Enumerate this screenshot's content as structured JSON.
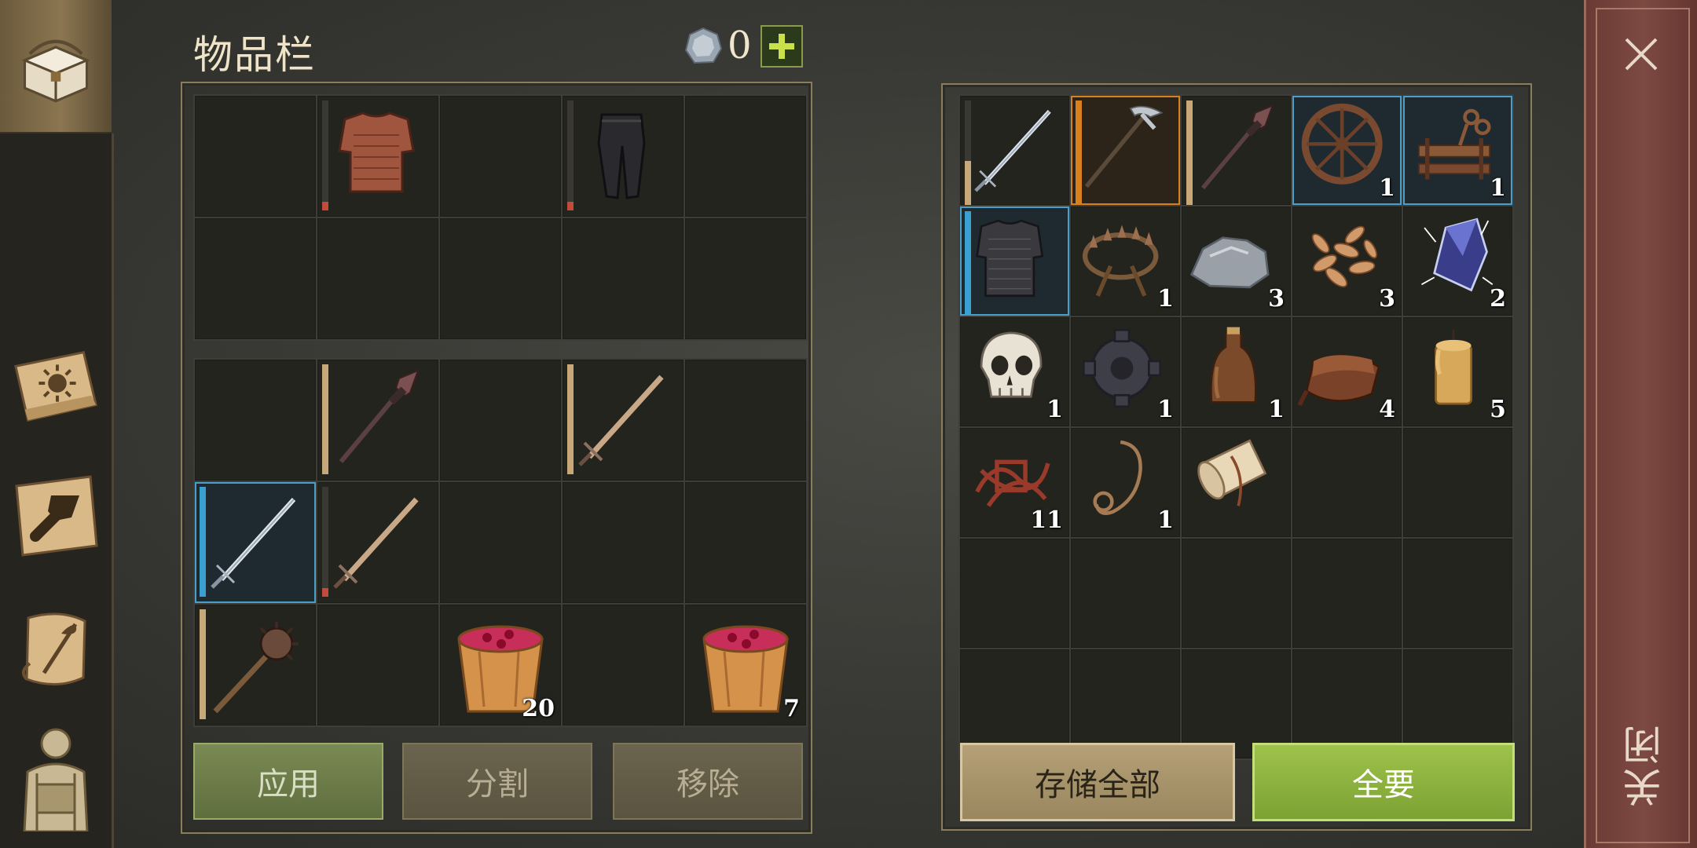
{
  "header": {
    "title": "物品栏",
    "currency_count": "0",
    "currency_icon": "silver-coin-icon",
    "add_icon": "plus-icon"
  },
  "sidebar": {
    "items": [
      {
        "icon": "chest-icon",
        "active": true
      },
      {
        "icon": "sun-book-icon"
      },
      {
        "icon": "hammer-map-icon"
      },
      {
        "icon": "scroll-quill-icon"
      },
      {
        "icon": "backpack-icon"
      }
    ]
  },
  "left_equipment": [
    {
      "item": "empty"
    },
    {
      "item": "chainmail-shirt",
      "durability": 0.08,
      "dur_color": "#c44a3a"
    },
    {
      "item": "empty"
    },
    {
      "item": "leather-pants",
      "durability": 0.08,
      "dur_color": "#c44a3a"
    },
    {
      "item": "empty"
    },
    {
      "item": "empty"
    },
    {
      "item": "empty"
    },
    {
      "item": "empty"
    },
    {
      "item": "empty"
    },
    {
      "item": "empty"
    }
  ],
  "left_inventory": [
    {
      "item": "empty"
    },
    {
      "item": "spear",
      "durability": 1.0,
      "dur_color": "#c8a878"
    },
    {
      "item": "empty"
    },
    {
      "item": "sword-bronze",
      "durability": 1.0,
      "dur_color": "#c8a878"
    },
    {
      "item": "empty"
    },
    {
      "item": "sword-steel",
      "durability": 1.0,
      "dur_color": "#3aa0d0",
      "selected": "blue"
    },
    {
      "item": "sword-bronze",
      "durability": 0.08,
      "dur_color": "#c44a3a"
    },
    {
      "item": "empty"
    },
    {
      "item": "empty"
    },
    {
      "item": "empty"
    },
    {
      "item": "mace",
      "durability": 1.0,
      "dur_color": "#c8a878"
    },
    {
      "item": "empty"
    },
    {
      "item": "berry-bucket",
      "count": "20"
    },
    {
      "item": "empty"
    },
    {
      "item": "berry-bucket",
      "count": "7"
    }
  ],
  "storage": [
    {
      "item": "sword-steel",
      "durability": 0.45,
      "dur_color": "#c8a878"
    },
    {
      "item": "pickaxe",
      "durability": 1.0,
      "dur_color": "#d8801e",
      "selected": "orange"
    },
    {
      "item": "spear",
      "durability": 1.0,
      "dur_color": "#c8a878"
    },
    {
      "item": "wheel",
      "count": "1",
      "selected": "blue"
    },
    {
      "item": "mechanism",
      "count": "1",
      "selected": "blue"
    },
    {
      "item": "chain-armor",
      "durability": 1.0,
      "dur_color": "#3aa0d0",
      "selected": "blue"
    },
    {
      "item": "bear-trap",
      "count": "1"
    },
    {
      "item": "stone",
      "count": "3"
    },
    {
      "item": "seeds",
      "count": "3"
    },
    {
      "item": "crystal",
      "count": "2"
    },
    {
      "item": "skull",
      "count": "1"
    },
    {
      "item": "gear",
      "count": "1"
    },
    {
      "item": "bottle",
      "count": "1"
    },
    {
      "item": "leather-roll",
      "count": "4"
    },
    {
      "item": "candle",
      "count": "5"
    },
    {
      "item": "tangled-cords",
      "count": "11"
    },
    {
      "item": "rope",
      "count": "1"
    },
    {
      "item": "scroll",
      "count": ""
    },
    {
      "item": "empty"
    },
    {
      "item": "empty"
    },
    {
      "item": "empty"
    },
    {
      "item": "empty"
    },
    {
      "item": "empty"
    },
    {
      "item": "empty"
    },
    {
      "item": "empty"
    },
    {
      "item": "empty"
    },
    {
      "item": "empty"
    },
    {
      "item": "empty"
    },
    {
      "item": "empty"
    },
    {
      "item": "empty"
    }
  ],
  "buttons": {
    "apply": "应用",
    "split": "分割",
    "remove": "移除",
    "store_all": "存储全部",
    "take_all": "全要"
  },
  "close": {
    "label": "关闭",
    "icon": "close-icon"
  }
}
